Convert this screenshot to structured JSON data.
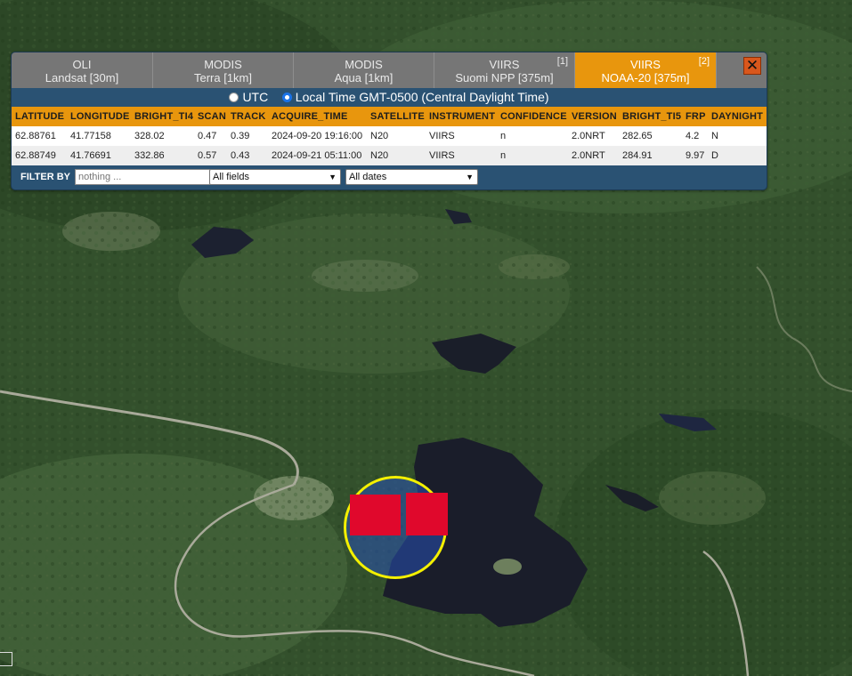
{
  "tabs": [
    {
      "line1": "OLI",
      "line2": "Landsat [30m]",
      "badge": ""
    },
    {
      "line1": "MODIS",
      "line2": "Terra [1km]",
      "badge": ""
    },
    {
      "line1": "MODIS",
      "line2": "Aqua [1km]",
      "badge": ""
    },
    {
      "line1": "VIIRS",
      "line2": "Suomi NPP [375m]",
      "badge": "[1]"
    },
    {
      "line1": "VIIRS",
      "line2": "NOAA-20 [375m]",
      "badge": "[2]",
      "active": true
    }
  ],
  "close_icon": "close-icon",
  "close_glyph": "✕",
  "time": {
    "utc_label": "UTC",
    "local_label": "Local Time GMT-0500 (Central Daylight Time)",
    "selected": "local"
  },
  "table": {
    "headers": [
      "LATITUDE",
      "LONGITUDE",
      "BRIGHT_TI4",
      "SCAN",
      "TRACK",
      "ACQUIRE_TIME",
      "SATELLITE",
      "INSTRUMENT",
      "CONFIDENCE",
      "VERSION",
      "BRIGHT_TI5",
      "FRP",
      "DAYNIGHT"
    ],
    "rows": [
      [
        "62.88761",
        "41.77158",
        "328.02",
        "0.47",
        "0.39",
        "2024-09-20 19:16:00",
        "N20",
        "VIIRS",
        "n",
        "2.0NRT",
        "282.65",
        "4.2",
        "N"
      ],
      [
        "62.88749",
        "41.76691",
        "332.86",
        "0.57",
        "0.43",
        "2024-09-21 05:11:00",
        "N20",
        "VIIRS",
        "n",
        "2.0NRT",
        "284.91",
        "9.97",
        "D"
      ]
    ]
  },
  "filter": {
    "label": "FILTER BY",
    "placeholder": "nothing ...",
    "fields_select": "All fields",
    "dates_select": "All dates"
  },
  "colors": {
    "tab_active": "#e8960d",
    "panel_bg": "#2a5273",
    "marker_ring": "#f4f000",
    "fire_pixel": "#e0082c"
  }
}
